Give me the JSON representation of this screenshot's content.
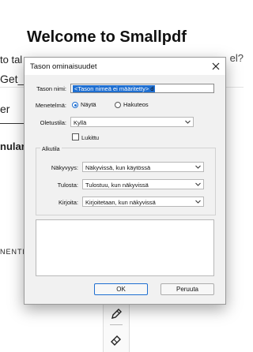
{
  "background": {
    "heading": "Welcome to Smallpdf",
    "line_left_1": "to tal",
    "line_left_2": "Get_S",
    "line_right": "el?",
    "tab_label": "er",
    "section_label": "nular",
    "section_label_2": "NENTE"
  },
  "dialog": {
    "title": "Tason ominaisuudet",
    "name_label": "Tason nimi:",
    "name_value": "<Tason nimeä ei määritetty>",
    "name_cursor": "d",
    "method_label": "Menetelmä:",
    "method_options": [
      {
        "label": "Näytä",
        "selected": true
      },
      {
        "label": "Hakuteos",
        "selected": false
      }
    ],
    "default_label": "Oletustila:",
    "default_value": "Kyllä",
    "locked_label": "Lukittu",
    "locked_checked": false,
    "group_title": "Alkutila",
    "visibility_label": "Näkyvyys:",
    "visibility_value": "Näkyvissä, kun käytössä",
    "print_label": "Tulosta:",
    "print_value": "Tulostuu, kun näkyvissä",
    "write_label": "Kirjoita:",
    "write_value": "Kirjoitetaan, kun näkyvissä",
    "ok_label": "OK",
    "cancel_label": "Peruuta"
  },
  "colors": {
    "accent": "#1f6fd1",
    "dialog_bg": "#f1f1f1"
  }
}
